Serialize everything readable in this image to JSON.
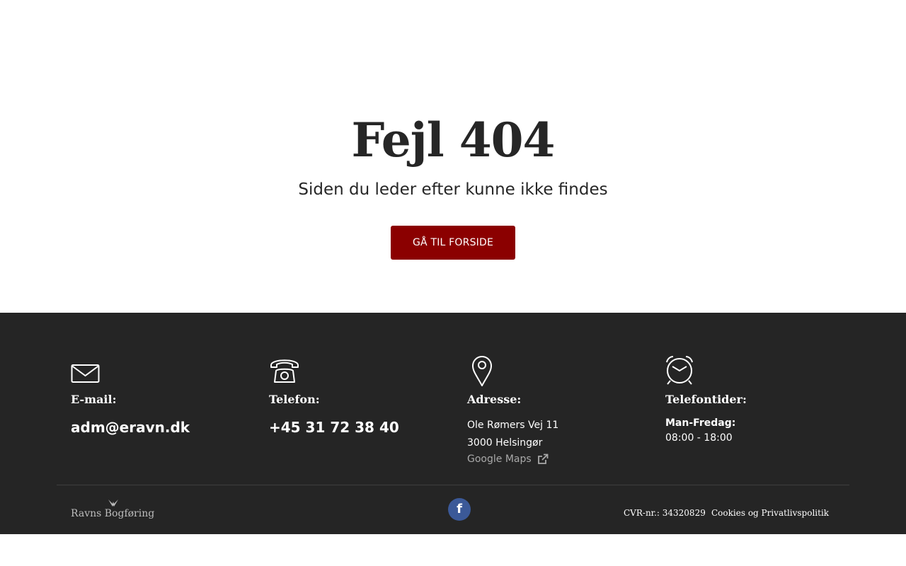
{
  "hero": {
    "title": "Fejl 404",
    "subtitle": "Siden du leder efter kunne ikke findes",
    "button_label": "GÅ TIL FORSIDE",
    "button_color": "#8b0000"
  },
  "footer": {
    "background": "#252525",
    "email": {
      "icon": "envelope-icon",
      "label": "E-mail:",
      "value": "adm@eravn.dk"
    },
    "phone": {
      "icon": "telephone-icon",
      "label": "Telefon:",
      "value": "+45 31 72 38 40"
    },
    "address": {
      "icon": "map-pin-icon",
      "label": "Adresse:",
      "line1": "Ole Rømers Vej 11",
      "line2": "3000 Helsingør",
      "maps_link": "Google Maps",
      "maps_icon": "external-link-icon"
    },
    "hours": {
      "icon": "alarm-clock-icon",
      "label": "Telefontider:",
      "days": "Man-Fredag:",
      "time": "08:00 - 18:00"
    },
    "logo_text": "Ravns Bogføring",
    "facebook": {
      "icon": "facebook-icon",
      "glyph": "f",
      "color": "#3b5998"
    },
    "cvr": "CVR-nr.: 34320829",
    "cookies_link": "Cookies og Privatlivspolitik"
  }
}
